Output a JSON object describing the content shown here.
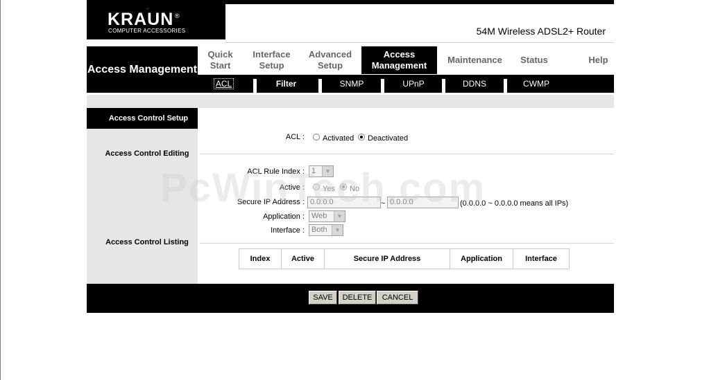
{
  "brand": {
    "logo_text": "KRAUN",
    "logo_reg": "®",
    "logo_subtitle": "COMPUTER ACCESSORIES",
    "product": "54M Wireless ADSL2+ Router"
  },
  "section_title": "Access Management",
  "main_tabs": [
    {
      "label": "Quick Start",
      "active": false
    },
    {
      "label": "Interface Setup",
      "active": false
    },
    {
      "label": "Advanced Setup",
      "active": false
    },
    {
      "label": "Access Management",
      "active": true
    },
    {
      "label": "Maintenance",
      "active": false
    },
    {
      "label": "Status",
      "active": false
    },
    {
      "label": "Help",
      "active": false
    }
  ],
  "sub_tabs": [
    {
      "label": "ACL",
      "current": true
    },
    {
      "label": "Filter",
      "bold": true
    },
    {
      "label": "SNMP"
    },
    {
      "label": "UPnP"
    },
    {
      "label": "DDNS"
    },
    {
      "label": "CWMP"
    }
  ],
  "left_labels": {
    "setup": "Access Control Setup",
    "editing": "Access Control Editing",
    "listing": "Access Control Listing"
  },
  "acl": {
    "label": "ACL :",
    "options": [
      "Activated",
      "Deactivated"
    ],
    "selected": "Deactivated"
  },
  "editing": {
    "rule_index_label": "ACL Rule Index :",
    "rule_index_value": "1",
    "active_label": "Active :",
    "active_options": [
      "Yes",
      "No"
    ],
    "active_selected": "No",
    "secure_ip_label": "Secure IP Address :",
    "ip_start": "0.0.0.0",
    "ip_separator": "~",
    "ip_end": "0.0.0.0",
    "ip_hint": "(0.0.0.0 ~ 0.0.0.0 means all IPs)",
    "application_label": "Application :",
    "application_value": "Web",
    "interface_label": "Interface :",
    "interface_value": "Both"
  },
  "listing": {
    "columns": [
      "Index",
      "Active",
      "Secure IP Address",
      "Application",
      "Interface"
    ]
  },
  "buttons": {
    "save": "SAVE",
    "delete": "DELETE",
    "cancel": "CANCEL"
  },
  "watermark": "PcWinTech.com"
}
